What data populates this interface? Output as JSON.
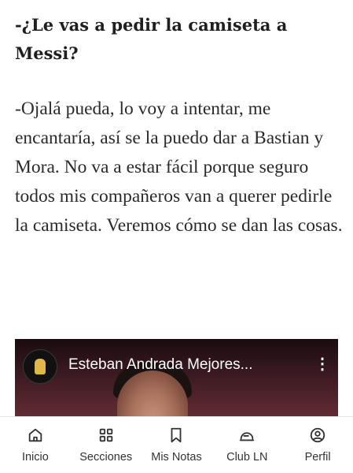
{
  "article": {
    "question": "-¿Le vas a pedir la camiseta a Messi?",
    "answer": "-Ojalá pueda, lo voy a intentar, me encantaría, así se la puedo dar a Bastian y Mora. No va a estar fácil porque seguro todos mis compañeros van a querer pedirle la camiseta. Veremos cómo se dan las cosas."
  },
  "video": {
    "title": "Esteban Andrada Mejores...",
    "menu_glyph": "⋮"
  },
  "navbar": {
    "items": [
      {
        "label": "Inicio",
        "icon": "home-icon"
      },
      {
        "label": "Secciones",
        "icon": "grid-icon"
      },
      {
        "label": "Mis Notas",
        "icon": "bookmark-icon"
      },
      {
        "label": "Club LN",
        "icon": "club-icon"
      },
      {
        "label": "Perfil",
        "icon": "profile-icon"
      }
    ]
  }
}
